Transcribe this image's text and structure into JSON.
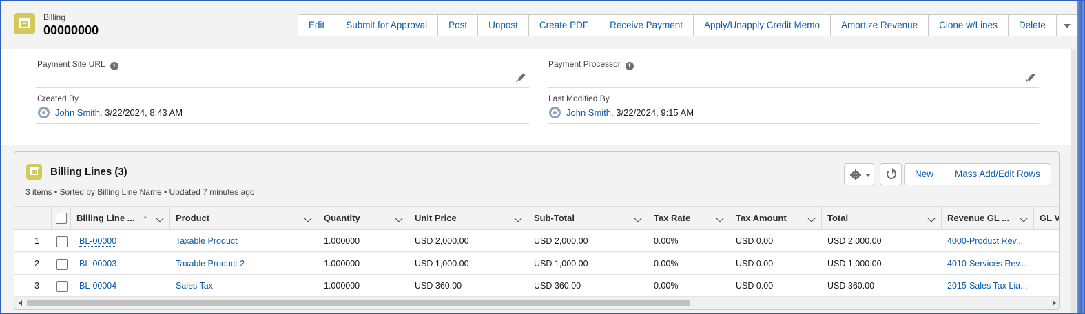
{
  "header": {
    "object_label": "Billing",
    "record_name": "00000000",
    "actions": [
      "Edit",
      "Submit for Approval",
      "Post",
      "Unpost",
      "Create PDF",
      "Receive Payment",
      "Apply/Unapply Credit Memo",
      "Amortize Revenue",
      "Clone w/Lines",
      "Delete"
    ]
  },
  "fields": {
    "payment_site_url": {
      "label": "Payment Site URL",
      "value": ""
    },
    "payment_processor": {
      "label": "Payment Processor",
      "value": ""
    },
    "created_by": {
      "label": "Created By",
      "user": "John Smith",
      "separator": ",",
      "timestamp": "3/22/2024, 8:43 AM"
    },
    "last_modified_by": {
      "label": "Last Modified By",
      "user": "John Smith",
      "separator": ",",
      "timestamp": "3/22/2024, 9:15 AM"
    }
  },
  "related_list": {
    "title": "Billing Lines (3)",
    "subtitle": "3 items • Sorted by Billing Line Name • Updated 7 minutes ago",
    "buttons": {
      "new": "New",
      "mass_add": "Mass Add/Edit Rows"
    },
    "columns": [
      "Billing Line ...",
      "Product",
      "Quantity",
      "Unit Price",
      "Sub-Total",
      "Tax Rate",
      "Tax Amount",
      "Total",
      "Revenue GL ...",
      "GL Va"
    ],
    "sort_indicator": "↑",
    "rows": [
      {
        "num": "1",
        "name": "BL-00000",
        "product": "Taxable Product",
        "quantity": "1.000000",
        "unit_price": "USD 2,000.00",
        "subtotal": "USD 2,000.00",
        "tax_rate": "0.00%",
        "tax_amount": "USD 0.00",
        "total": "USD 2,000.00",
        "revenue_gl": "4000-Product Rev..."
      },
      {
        "num": "2",
        "name": "BL-00003",
        "product": "Taxable Product 2",
        "quantity": "1.000000",
        "unit_price": "USD 1,000.00",
        "subtotal": "USD 1,000.00",
        "tax_rate": "0.00%",
        "tax_amount": "USD 0.00",
        "total": "USD 1,000.00",
        "revenue_gl": "4010-Services Rev..."
      },
      {
        "num": "3",
        "name": "BL-00004",
        "product": "Sales Tax",
        "quantity": "1.000000",
        "unit_price": "USD 360.00",
        "subtotal": "USD 360.00",
        "tax_rate": "0.00%",
        "tax_amount": "USD 0.00",
        "total": "USD 360.00",
        "revenue_gl": "2015-Sales Tax Lia..."
      }
    ]
  },
  "colors": {
    "accent_link": "#0b5cab",
    "object_icon": "#d2ca5c",
    "border": "#c9c9c9"
  },
  "icons": [
    "billing-object-icon",
    "info-icon",
    "pencil-icon",
    "user-avatar-icon",
    "gear-icon",
    "refresh-icon",
    "chevron-down-icon",
    "sort-up-icon"
  ]
}
